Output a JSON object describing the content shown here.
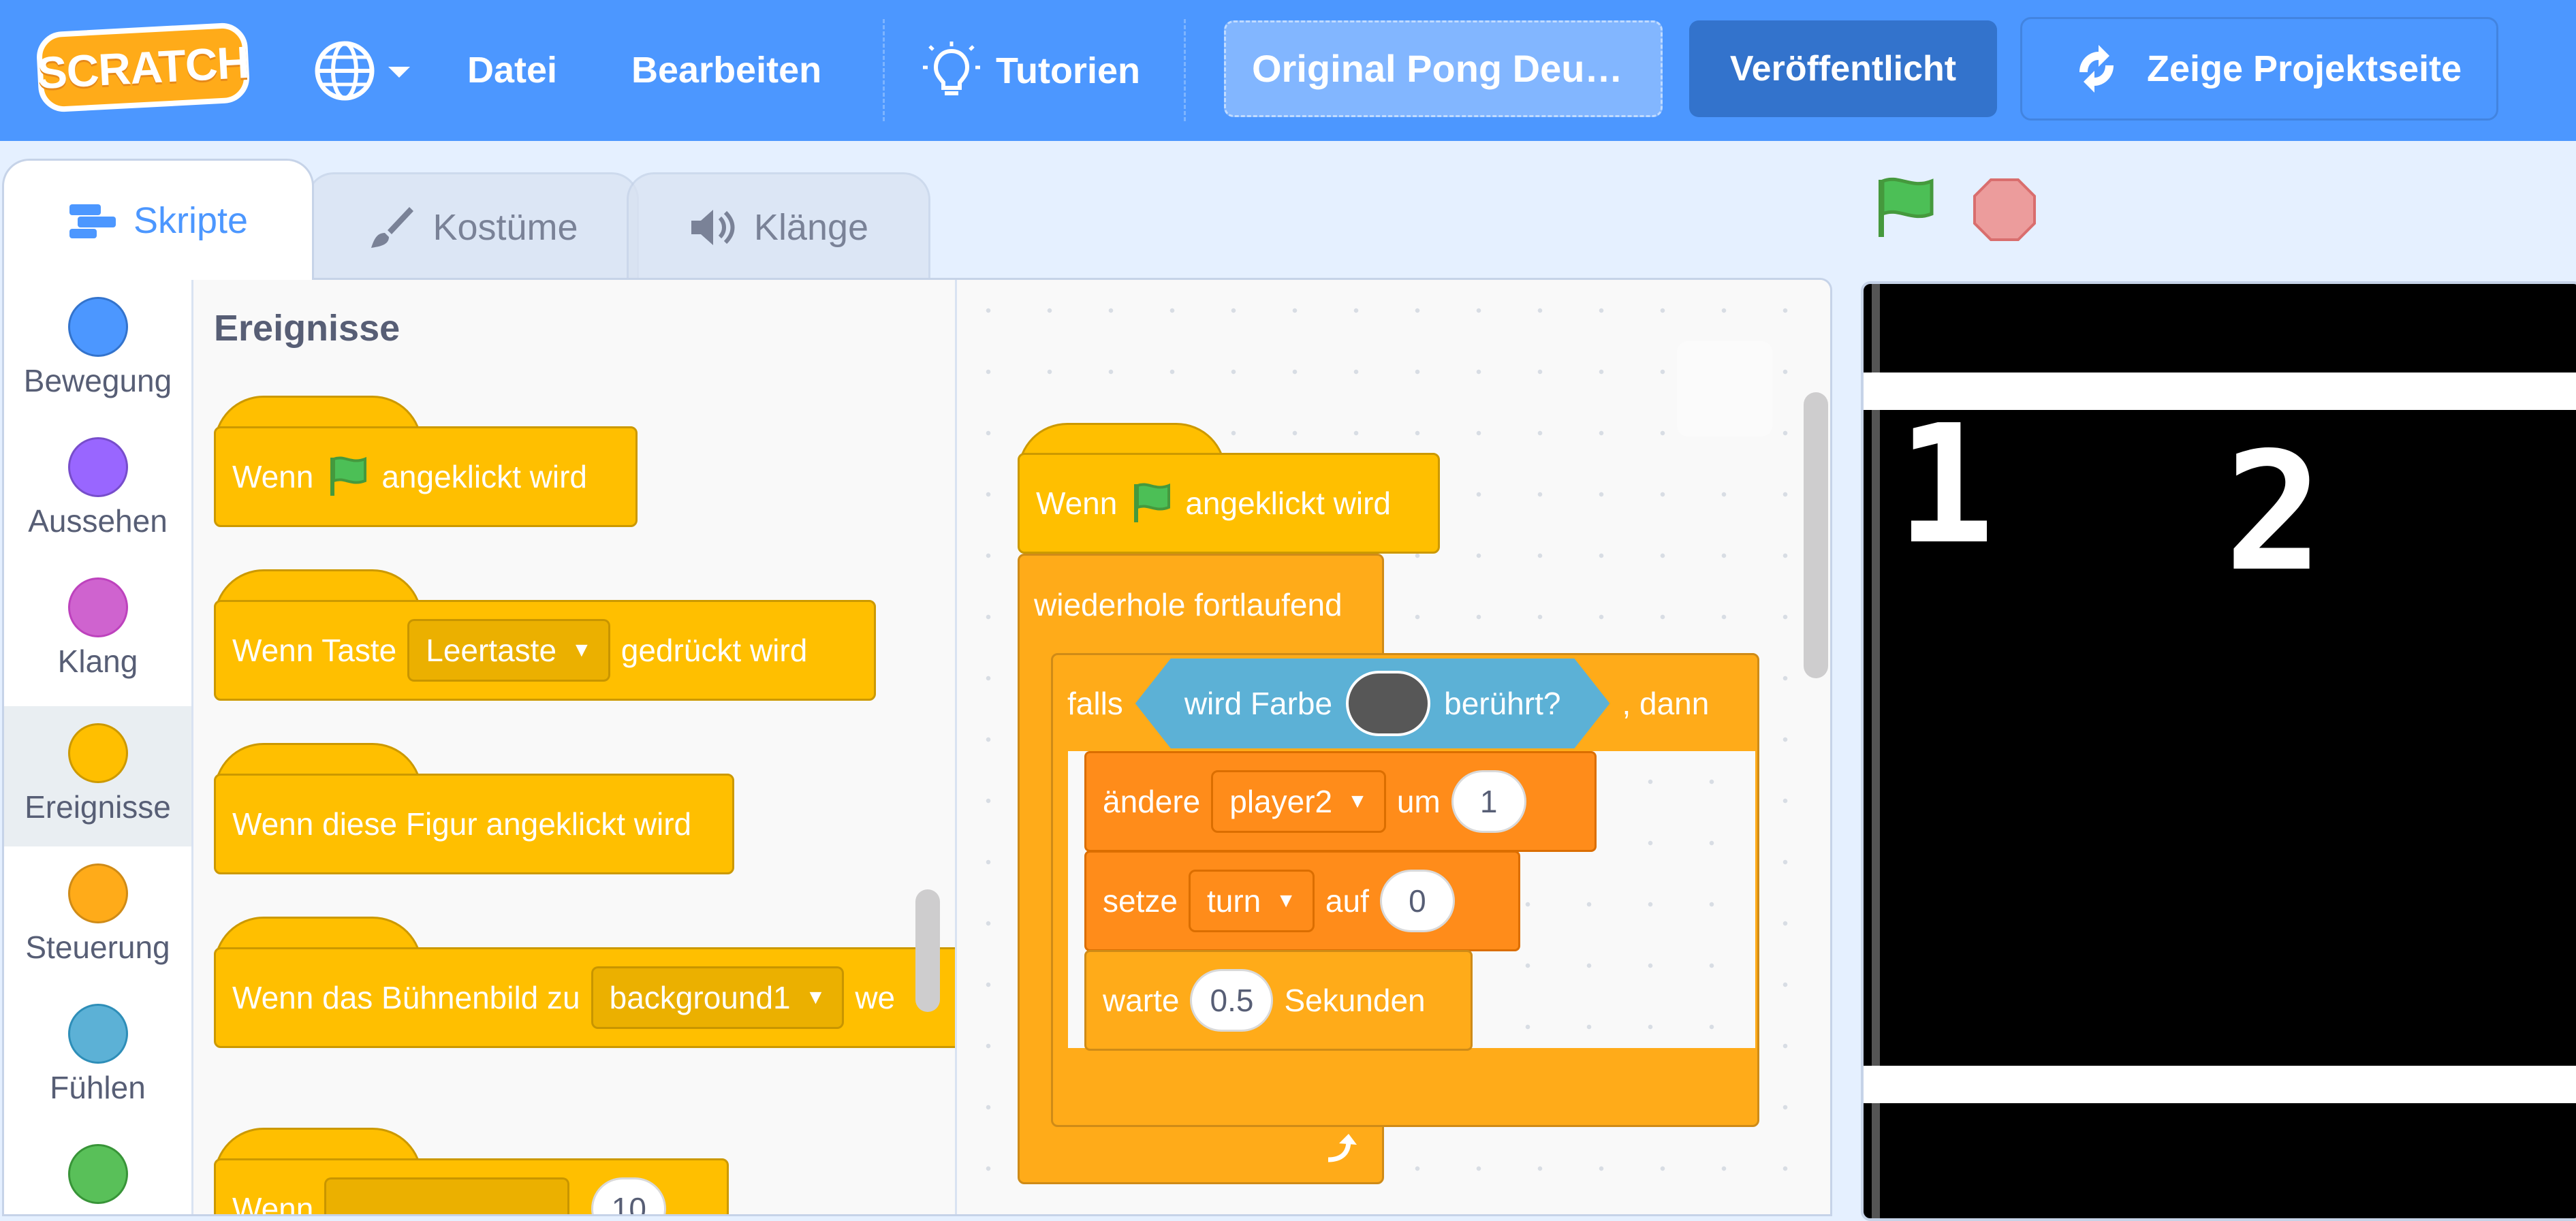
{
  "menubar": {
    "logo": "SCRATCH",
    "menu_file": "Datei",
    "menu_edit": "Bearbeiten",
    "menu_tutorials": "Tutorien",
    "project_title": "Original Pong Deu…",
    "share_button": "Veröffentlicht",
    "project_page_button": "Zeige Projektseite"
  },
  "tabs": {
    "scripts": "Skripte",
    "costumes": "Kostüme",
    "sounds": "Klänge"
  },
  "categories": [
    {
      "label": "Bewegung",
      "color": "#4c97ff"
    },
    {
      "label": "Aussehen",
      "color": "#9966ff"
    },
    {
      "label": "Klang",
      "color": "#cf63cf"
    },
    {
      "label": "Ereignisse",
      "color": "#ffbf00"
    },
    {
      "label": "Steuerung",
      "color": "#ffab19"
    },
    {
      "label": "Fühlen",
      "color": "#5cb1d6"
    },
    {
      "label": "",
      "color": "#59c059"
    }
  ],
  "palette": {
    "heading": "Ereignisse",
    "flag_block": {
      "pre": "Wenn",
      "post": "angeklickt wird"
    },
    "key_block": {
      "pre": "Wenn Taste",
      "key": "Leertaste",
      "post": "gedrückt wird"
    },
    "sprite_click_block": "Wenn diese Figur angeklickt wird",
    "backdrop_block": {
      "pre": "Wenn das Bühnenbild zu",
      "value": "background1",
      "post": "we"
    },
    "partial_block": {
      "pre": "Wenn",
      "value": "10"
    }
  },
  "script": {
    "hat": {
      "pre": "Wenn",
      "post": "angeklickt wird"
    },
    "forever": "wiederhole fortlaufend",
    "if": {
      "pre": "falls",
      "post": ", dann"
    },
    "touching_color": {
      "pre": "wird Farbe",
      "post": "berührt?",
      "color": "#575757"
    },
    "change_var": {
      "pre": "ändere",
      "var": "player2",
      "mid": "um",
      "value": "1"
    },
    "set_var": {
      "pre": "setze",
      "var": "turn",
      "mid": "auf",
      "value": "0"
    },
    "wait": {
      "pre": "warte",
      "value": "0.5",
      "post": "Sekunden"
    }
  },
  "stage": {
    "score_left": "1",
    "score_right": "2"
  },
  "colors": {
    "menubar": "#4c97ff",
    "events": "#ffbf00",
    "control": "#ffab19",
    "variables": "#ff8c1a",
    "sensing": "#5cb1d6"
  }
}
